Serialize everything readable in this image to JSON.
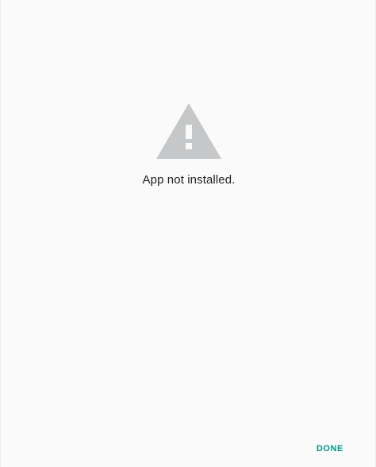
{
  "dialog": {
    "icon": "warning-triangle-icon",
    "message": "App not installed.",
    "done_label": "DONE"
  },
  "colors": {
    "background": "#fafafa",
    "icon": "#c5c7c9",
    "text": "#212121",
    "accent": "#009688"
  }
}
